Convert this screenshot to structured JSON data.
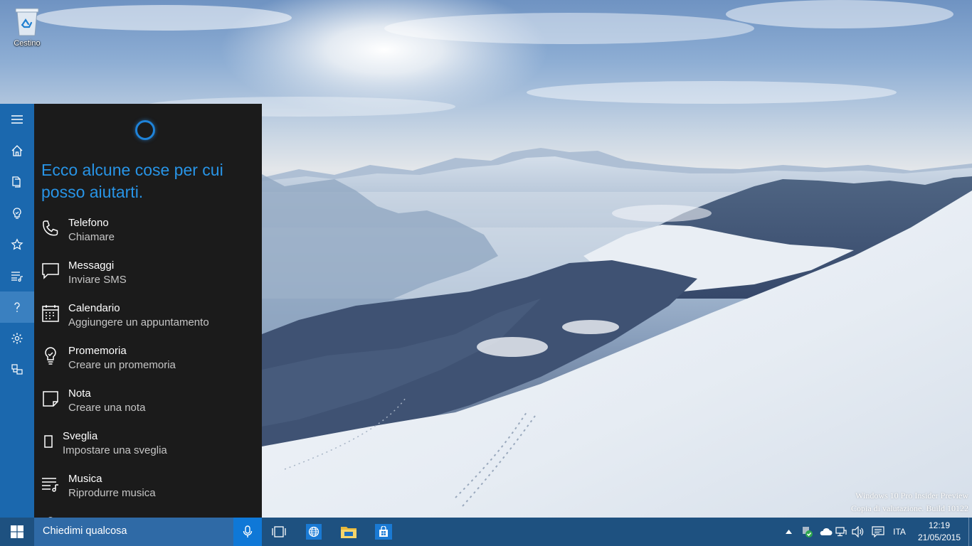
{
  "desktop": {
    "recycle_bin_label": "Cestino",
    "watermark_line1": "Windows 10 Pro Insider Preview",
    "watermark_line2": "Copia di valutazione. Build 10122"
  },
  "cortana": {
    "rail_icons": [
      "menu-icon",
      "home-icon",
      "notebook-icon",
      "lightbulb-icon",
      "star-icon",
      "list-music-icon",
      "help-icon",
      "settings-icon",
      "feedback-icon"
    ],
    "greeting": "Ecco alcune cose per cui posso aiutarti.",
    "items": [
      {
        "title": "Telefono",
        "subtitle": "Chiamare"
      },
      {
        "title": "Messaggi",
        "subtitle": "Inviare SMS"
      },
      {
        "title": "Calendario",
        "subtitle": "Aggiungere un appuntamento"
      },
      {
        "title": "Promemoria",
        "subtitle": "Creare un promemoria"
      },
      {
        "title": "Nota",
        "subtitle": "Creare una nota"
      },
      {
        "title": "Sveglia",
        "subtitle": "Impostare una sveglia"
      },
      {
        "title": "Musica",
        "subtitle": "Riprodurre musica"
      }
    ]
  },
  "taskbar": {
    "search_placeholder": "Chiedimi qualcosa",
    "language": "ITA",
    "time": "12:19",
    "date": "21/05/2015"
  },
  "colors": {
    "accent": "#1f83d9",
    "rail": "#1b68ae",
    "panel": "#1b1b1b",
    "taskbar": "#1e5180"
  }
}
